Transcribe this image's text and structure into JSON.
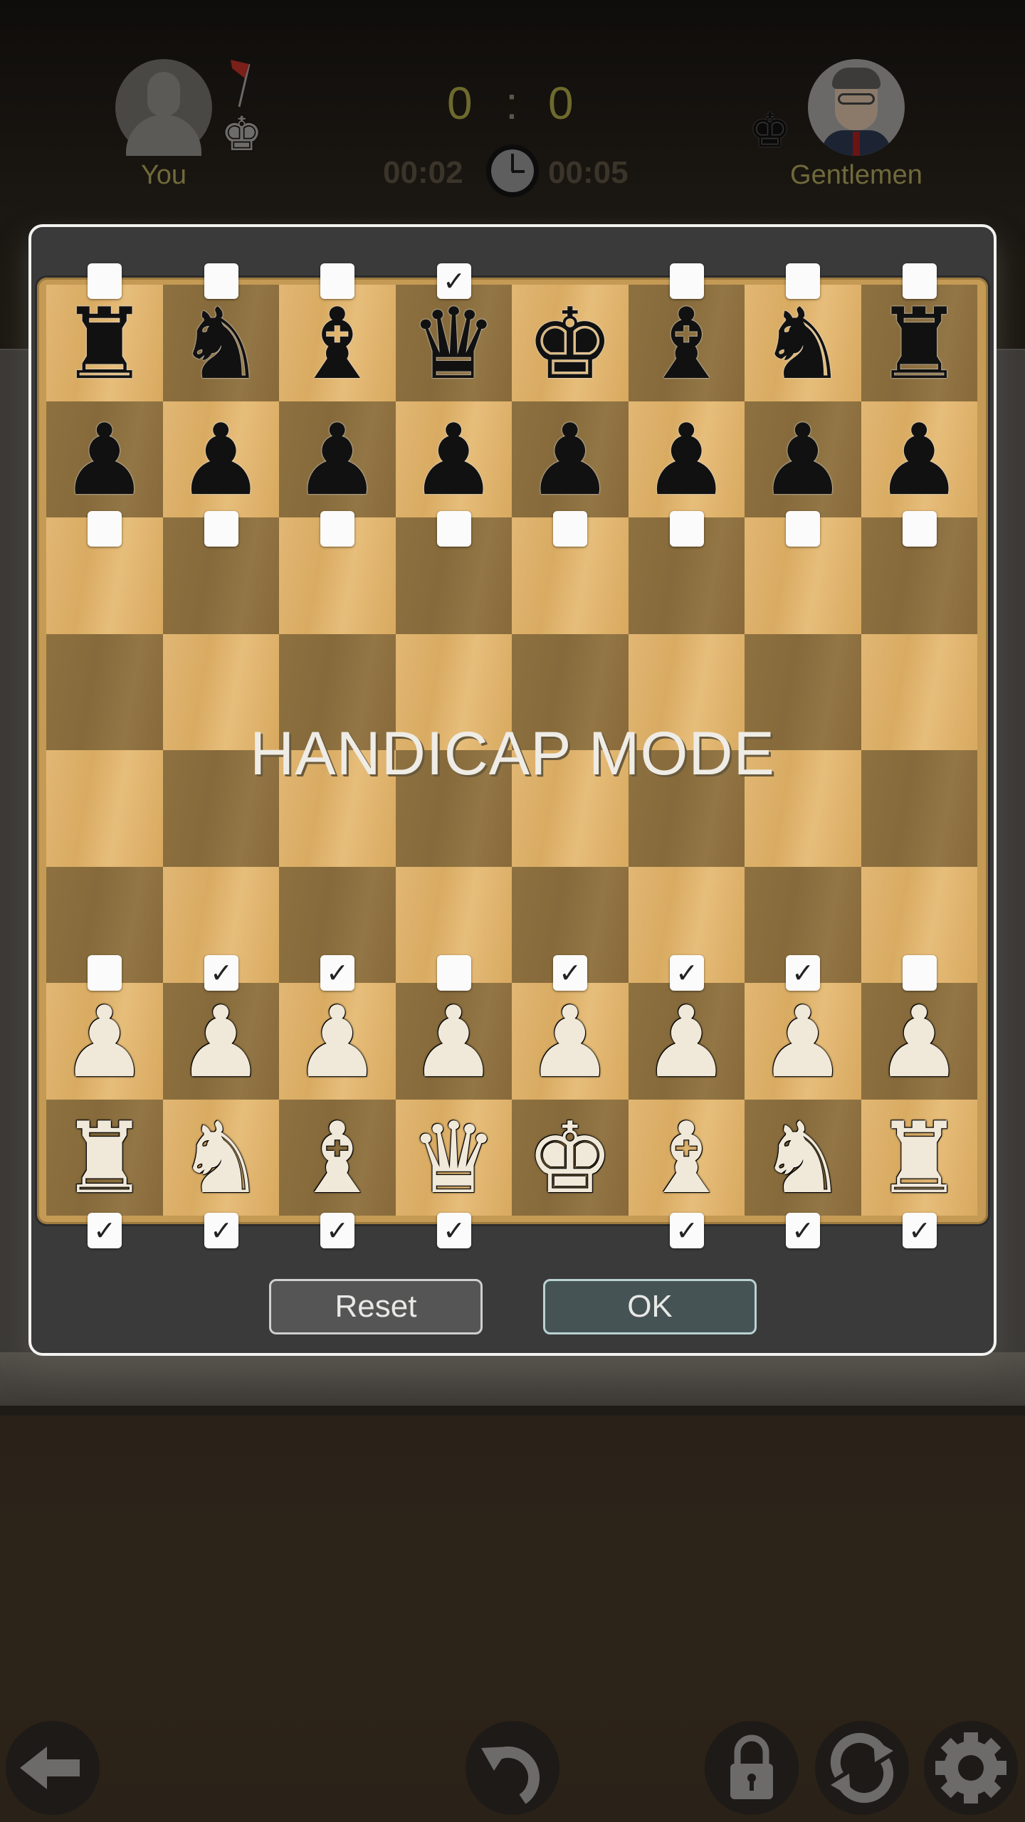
{
  "header": {
    "player": {
      "name": "You",
      "piece_color": "white",
      "avatar": "default-avatar",
      "flag": "red-flag"
    },
    "opponent": {
      "name": "Gentlemen",
      "piece_color": "black",
      "avatar": "gentleman-avatar"
    },
    "score": {
      "player": "0",
      "separator": ":",
      "opponent": "0"
    },
    "timers": {
      "player": "00:02",
      "opponent": "00:05"
    },
    "icons": {
      "clock": "clock-icon",
      "player_king": "white-king-icon",
      "opponent_king": "black-king-icon"
    }
  },
  "dialog": {
    "title": "HANDICAP MODE",
    "board": {
      "squares_top_left": "light",
      "ranks": [
        [
          "r",
          "n",
          "b",
          "q",
          "k",
          "b",
          "n",
          "r"
        ],
        [
          "p",
          "p",
          "p",
          "p",
          "p",
          "p",
          "p",
          "p"
        ],
        [
          "",
          "",
          "",
          "",
          "",
          "",
          "",
          ""
        ],
        [
          "",
          "",
          "",
          "",
          "",
          "",
          "",
          ""
        ],
        [
          "",
          "",
          "",
          "",
          "",
          "",
          "",
          ""
        ],
        [
          "",
          "",
          "",
          "",
          "",
          "",
          "",
          ""
        ],
        [
          "P",
          "P",
          "P",
          "P",
          "P",
          "P",
          "P",
          "P"
        ],
        [
          "R",
          "N",
          "B",
          "Q",
          "K",
          "B",
          "N",
          "R"
        ]
      ]
    },
    "checkboxes": {
      "black_pieces": [
        false,
        false,
        false,
        true,
        null,
        false,
        false,
        false
      ],
      "black_pawns": [
        false,
        false,
        false,
        false,
        false,
        false,
        false,
        false
      ],
      "white_pawns": [
        false,
        true,
        true,
        false,
        true,
        true,
        true,
        false
      ],
      "white_pieces": [
        true,
        true,
        true,
        true,
        null,
        true,
        true,
        true
      ]
    },
    "buttons": {
      "reset": "Reset",
      "ok": "OK"
    }
  },
  "toolbar": {
    "items": [
      {
        "id": "back",
        "icon": "back-arrow-icon"
      },
      {
        "id": "undo",
        "icon": "undo-icon"
      },
      {
        "id": "lock",
        "icon": "lock-icon"
      },
      {
        "id": "flip",
        "icon": "flip-board-icon"
      },
      {
        "id": "settings",
        "icon": "gear-icon"
      }
    ]
  },
  "glyphs": {
    "K": "♚",
    "Q": "♛",
    "R": "♜",
    "B": "♝",
    "N": "♞",
    "P": "♟",
    "check": "✓"
  }
}
